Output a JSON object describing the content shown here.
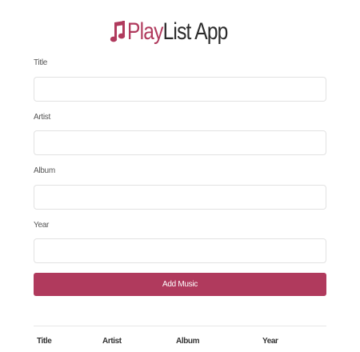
{
  "header": {
    "title_play": "Play",
    "title_list": "List App",
    "accent_color": "#b03a5d",
    "logo_icon": "music-note-icon"
  },
  "form": {
    "title_label": "Title",
    "title_value": "",
    "artist_label": "Artist",
    "artist_value": "",
    "album_label": "Album",
    "album_value": "",
    "year_label": "Year",
    "year_value": ""
  },
  "actions": {
    "add_button_label": "Add Music"
  },
  "table": {
    "columns": [
      "Title",
      "Artist",
      "Album",
      "Year"
    ]
  }
}
